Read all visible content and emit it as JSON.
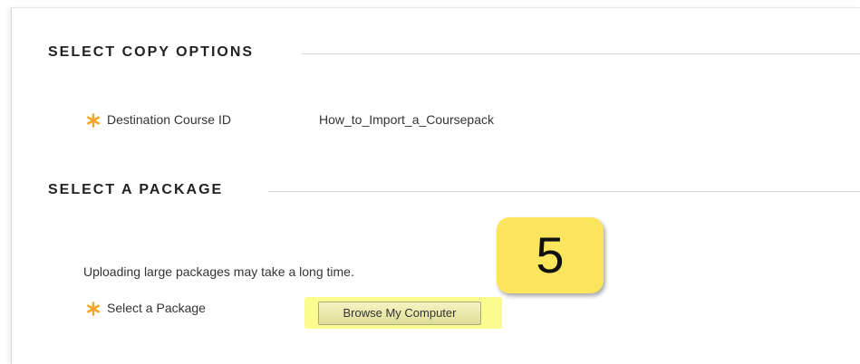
{
  "copy_options": {
    "heading": "SELECT COPY OPTIONS",
    "destination_label": "Destination Course ID",
    "destination_value": "How_to_Import_a_Coursepack"
  },
  "package": {
    "heading": "SELECT A PACKAGE",
    "note": "Uploading large packages may take a long time.",
    "select_label": "Select a Package",
    "browse_label": "Browse My Computer"
  },
  "callout": {
    "step_number": "5"
  },
  "colors": {
    "required_icon": "#f5a623",
    "highlight": "#fbfb8e",
    "callout_fill": "#fae55d"
  },
  "icons": {
    "required": "asterisk-icon"
  }
}
